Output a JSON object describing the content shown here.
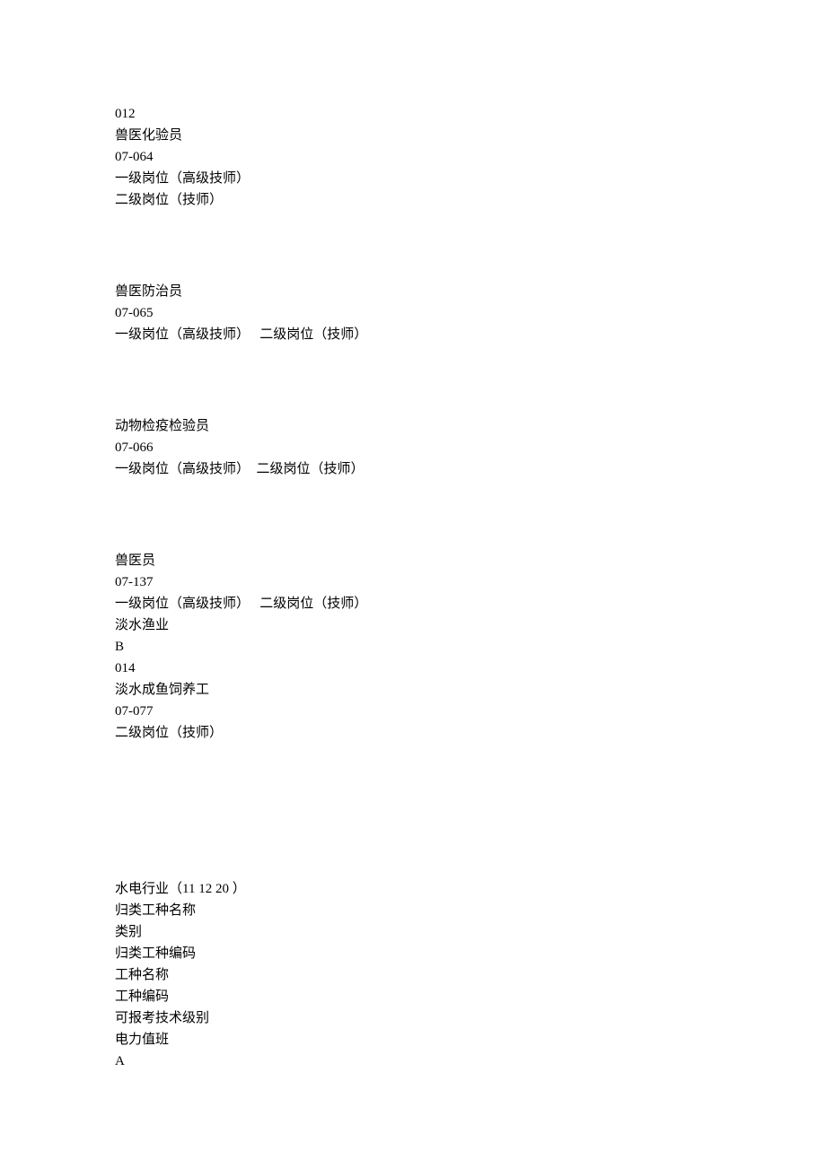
{
  "block1": {
    "l1": "012",
    "l2": "兽医化验员",
    "l3": "07-064",
    "l4": "一级岗位（高级技师）",
    "l5": "二级岗位（技师）"
  },
  "block2": {
    "l1": "兽医防治员",
    "l2": "07-065",
    "l3": "一级岗位（高级技师）   二级岗位（技师）"
  },
  "block3": {
    "l1": "动物检疫检验员",
    "l2": "07-066",
    "l3": "一级岗位（高级技师）  二级岗位（技师）"
  },
  "block4": {
    "l1": "兽医员",
    "l2": "07-137",
    "l3": "一级岗位（高级技师）   二级岗位（技师）",
    "l4": "淡水渔业",
    "l5": "B",
    "l6": "014",
    "l7": "淡水成鱼饲养工",
    "l8": "07-077",
    "l9": "二级岗位（技师）"
  },
  "block5": {
    "l1": "水电行业（11 12 20 ）",
    "l2": "归类工种名称",
    "l3": "类别",
    "l4": "归类工种编码",
    "l5": "工种名称",
    "l6": "工种编码",
    "l7": "可报考技术级别",
    "l8": "电力值班",
    "l9": "A"
  }
}
